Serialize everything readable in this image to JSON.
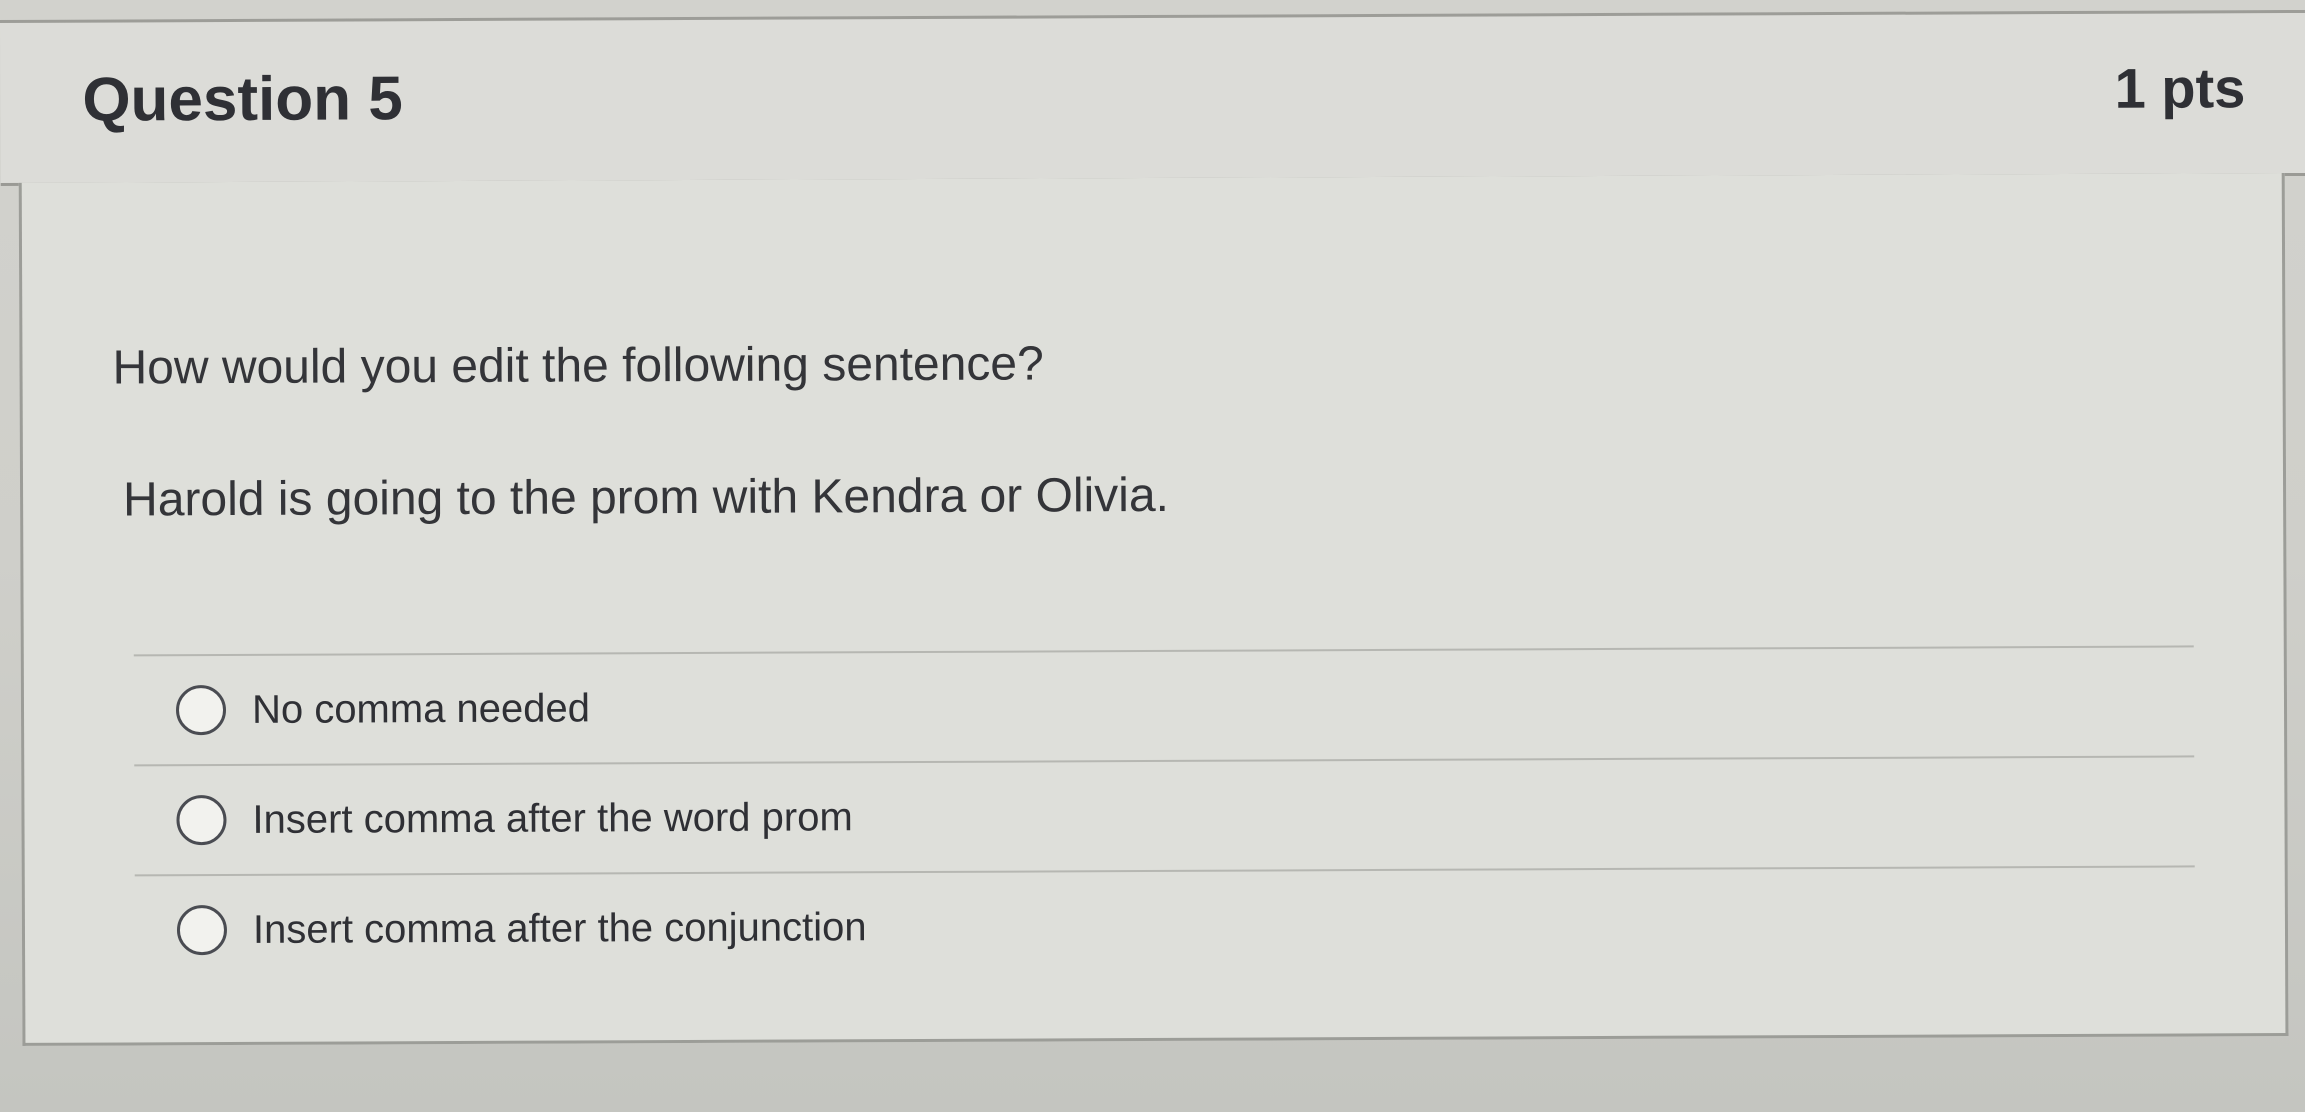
{
  "question": {
    "title": "Question 5",
    "points": "1 pts",
    "prompt": "How would you edit the following sentence?",
    "sentence": "Harold is going to the prom with Kendra or Olivia."
  },
  "answers": [
    {
      "label": "No comma needed",
      "selected": false
    },
    {
      "label": "Insert comma after the word prom",
      "selected": false
    },
    {
      "label": "Insert comma after the conjunction",
      "selected": false
    }
  ],
  "colors": {
    "text": "#2f3035",
    "header_background": "#dcdcd8",
    "body_background": "#dedfda",
    "border": "#9c9d98"
  }
}
